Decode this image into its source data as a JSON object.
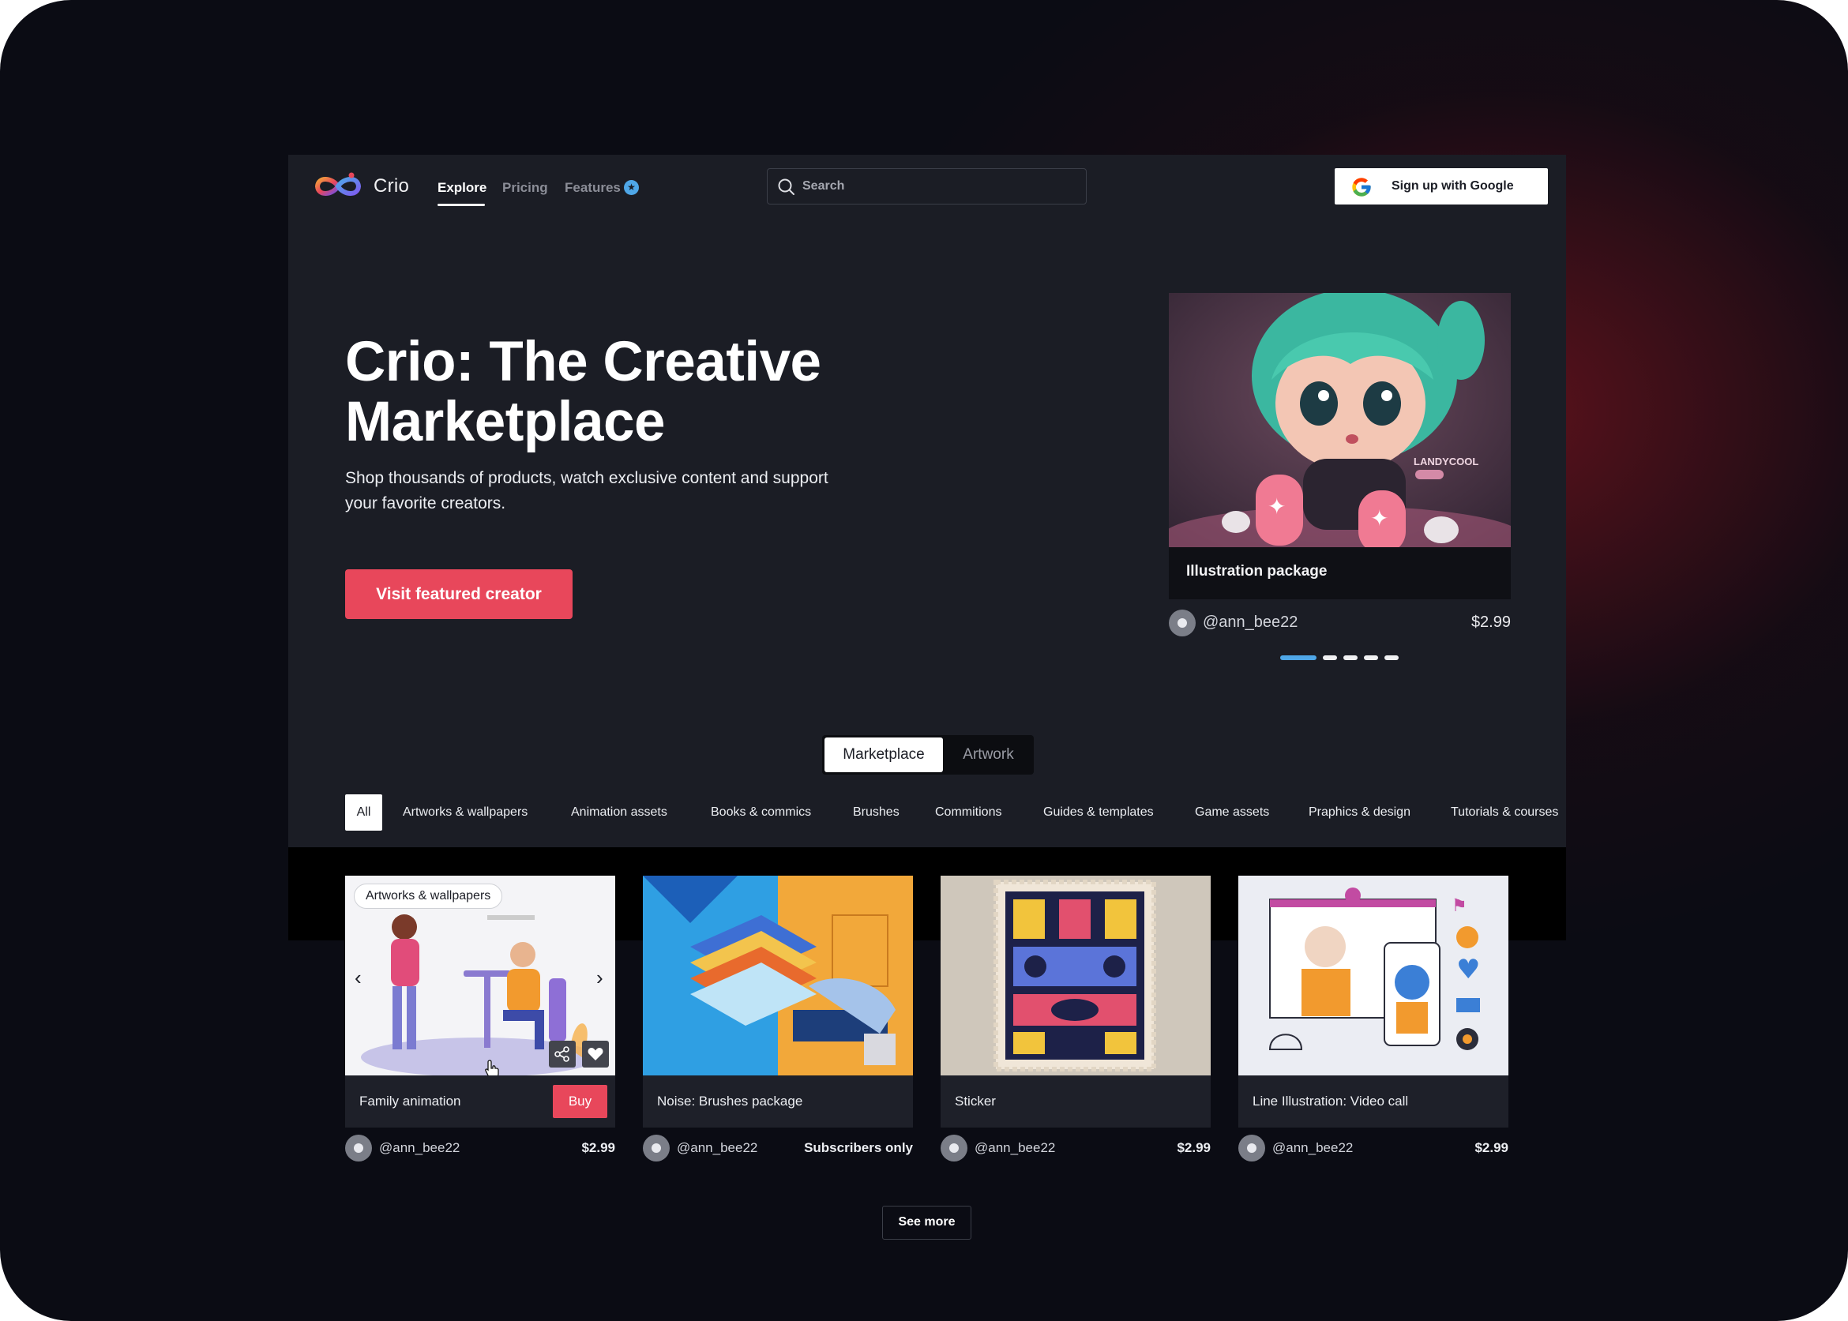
{
  "nav": {
    "brand": "Crio",
    "links": [
      {
        "label": "Explore",
        "active": true
      },
      {
        "label": "Pricing",
        "active": false
      },
      {
        "label": "Features",
        "active": false
      }
    ],
    "features_badge_icon": "star-icon",
    "search_placeholder": "Search",
    "signup_label": "Sign up with Google"
  },
  "hero": {
    "title": "Crio: The Creative Marketplace",
    "subtitle": "Shop thousands of products, watch exclusive content and support your favorite creators.",
    "cta": "Visit featured creator"
  },
  "featured": {
    "title": "Illustration package",
    "user": "@ann_bee22",
    "price": "$2.99",
    "image_watermark": "LANDYCOOL",
    "carousel_total": 5,
    "carousel_active": 1
  },
  "segments": {
    "active": "Marketplace",
    "inactive": "Artwork"
  },
  "categories": [
    "All",
    "Artworks & wallpapers",
    "Animation assets",
    "Books & commics",
    "Brushes",
    "Commitions",
    "Guides & templates",
    "Game assets",
    "Praphics & design",
    "Tutorials & courses"
  ],
  "products": [
    {
      "title": "Family animation",
      "user": "@ann_bee22",
      "price": "$2.99",
      "tag": "Artworks & wallpapers",
      "buy_label": "Buy"
    },
    {
      "title": "Noise: Brushes package",
      "user": "@ann_bee22",
      "price": "Subscribers only"
    },
    {
      "title": "Sticker",
      "user": "@ann_bee22",
      "price": "$2.99"
    },
    {
      "title": "Line Illustration: Video call",
      "user": "@ann_bee22",
      "price": "$2.99"
    }
  ],
  "see_more": "See more",
  "colors": {
    "accent": "#e8475b",
    "blue": "#4fa7e8",
    "app_bg": "#1b1d25",
    "caption_bg": "#1e2029"
  }
}
